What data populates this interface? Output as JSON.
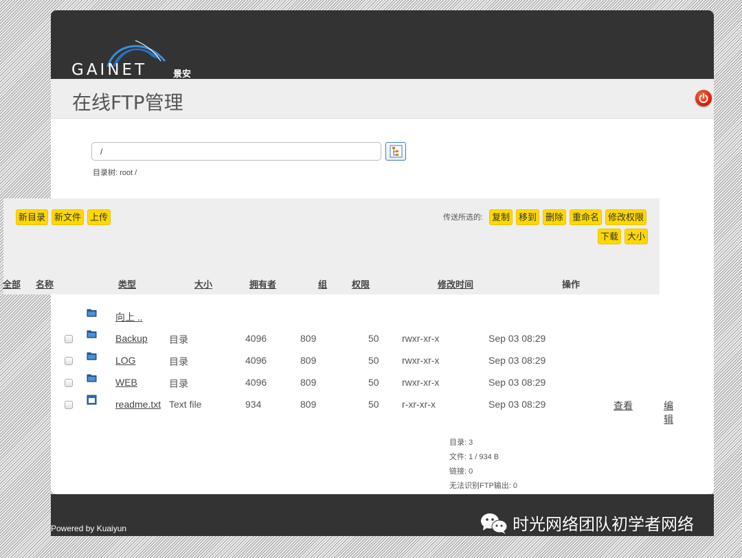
{
  "header": {
    "logo_text": "GAINET",
    "logo_text_cn": "景安"
  },
  "title": "在线FTP管理",
  "path": {
    "value": "/",
    "dir_tree_label": "目录树: root /"
  },
  "toolbar": {
    "new_dir": "新目录",
    "new_file": "新文件",
    "upload": "上传",
    "transfer_label": "传送所选的:",
    "copy": "复制",
    "move": "移到",
    "delete": "删除",
    "rename": "重命名",
    "chmod": "修改权限",
    "download": "下载",
    "size": "大小"
  },
  "table": {
    "headers": {
      "all": "全部",
      "name": "名称",
      "type": "类型",
      "size": "大小",
      "owner": "拥有者",
      "group": "组",
      "perms": "权限",
      "mtime": "修改时间",
      "actions": "操作"
    },
    "up_label": "向上 ..",
    "rows": [
      {
        "name": "Backup",
        "type": "目录",
        "size": "4096",
        "owner": "809",
        "group": "50",
        "perms": "rwxr-xr-x",
        "mtime": "Sep 03 08:29",
        "icon": "folder-icon"
      },
      {
        "name": "LOG",
        "type": "目录",
        "size": "4096",
        "owner": "809",
        "group": "50",
        "perms": "rwxr-xr-x",
        "mtime": "Sep 03 08:29",
        "icon": "folder-icon"
      },
      {
        "name": "WEB",
        "type": "目录",
        "size": "4096",
        "owner": "809",
        "group": "50",
        "perms": "rwxr-xr-x",
        "mtime": "Sep 03 08:29",
        "icon": "folder-icon"
      },
      {
        "name": "readme.txt",
        "type": "Text file",
        "size": "934",
        "owner": "809",
        "group": "50",
        "perms": "r-xr-xr-x",
        "mtime": "Sep 03 08:29",
        "icon": "file-icon",
        "view": "查看",
        "edit": "编辑"
      }
    ]
  },
  "stats": {
    "dirs": "目录: 3",
    "files": "文件: 1 / 934 B",
    "links": "链接: 0",
    "unrecognized": "无法识别FTP输出: 0"
  },
  "footer": {
    "powered_by": "Powered by Kuaiyun",
    "watermark": "时光网络团队初学者网络"
  },
  "colors": {
    "header_bg": "#333333",
    "button_yellow": "#ffd800",
    "power_red": "#d21a00",
    "folder_blue": "#1f5fa8"
  }
}
